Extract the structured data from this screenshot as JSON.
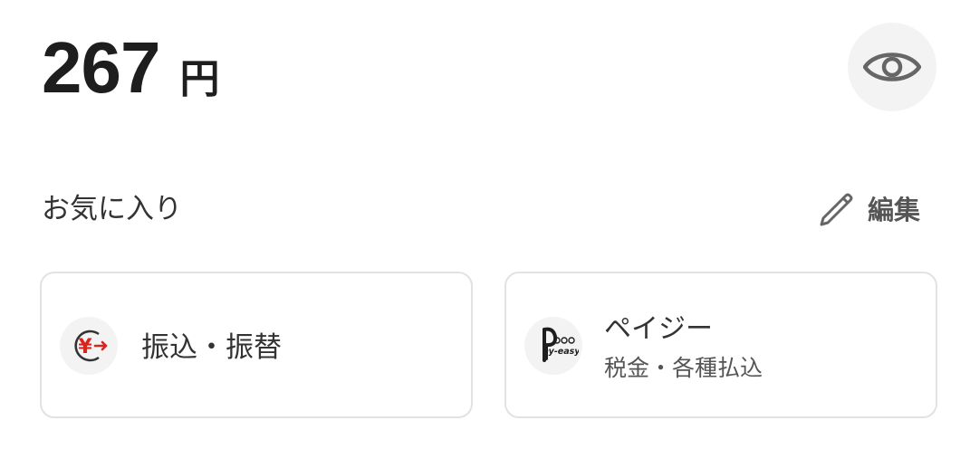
{
  "balance": {
    "amount": "267",
    "unit": "円"
  },
  "visibility_toggle": {
    "icon": "eye-icon"
  },
  "favorites": {
    "title": "お気に入り",
    "edit_label": "編集",
    "edit_icon": "pencil-icon",
    "items": [
      {
        "label": "振込・振替",
        "icon": "yen-transfer-icon",
        "icon_text": "¥"
      },
      {
        "label": "ペイジー",
        "sublabel": "税金・各種払込",
        "icon": "pay-easy-logo",
        "logo_text": "ay-easy"
      }
    ]
  },
  "colors": {
    "text_primary": "#1e1e1e",
    "text_secondary": "#555555",
    "accent_red": "#d7261e",
    "card_border": "#e2e2e2",
    "icon_bg": "#f3f3f3"
  }
}
